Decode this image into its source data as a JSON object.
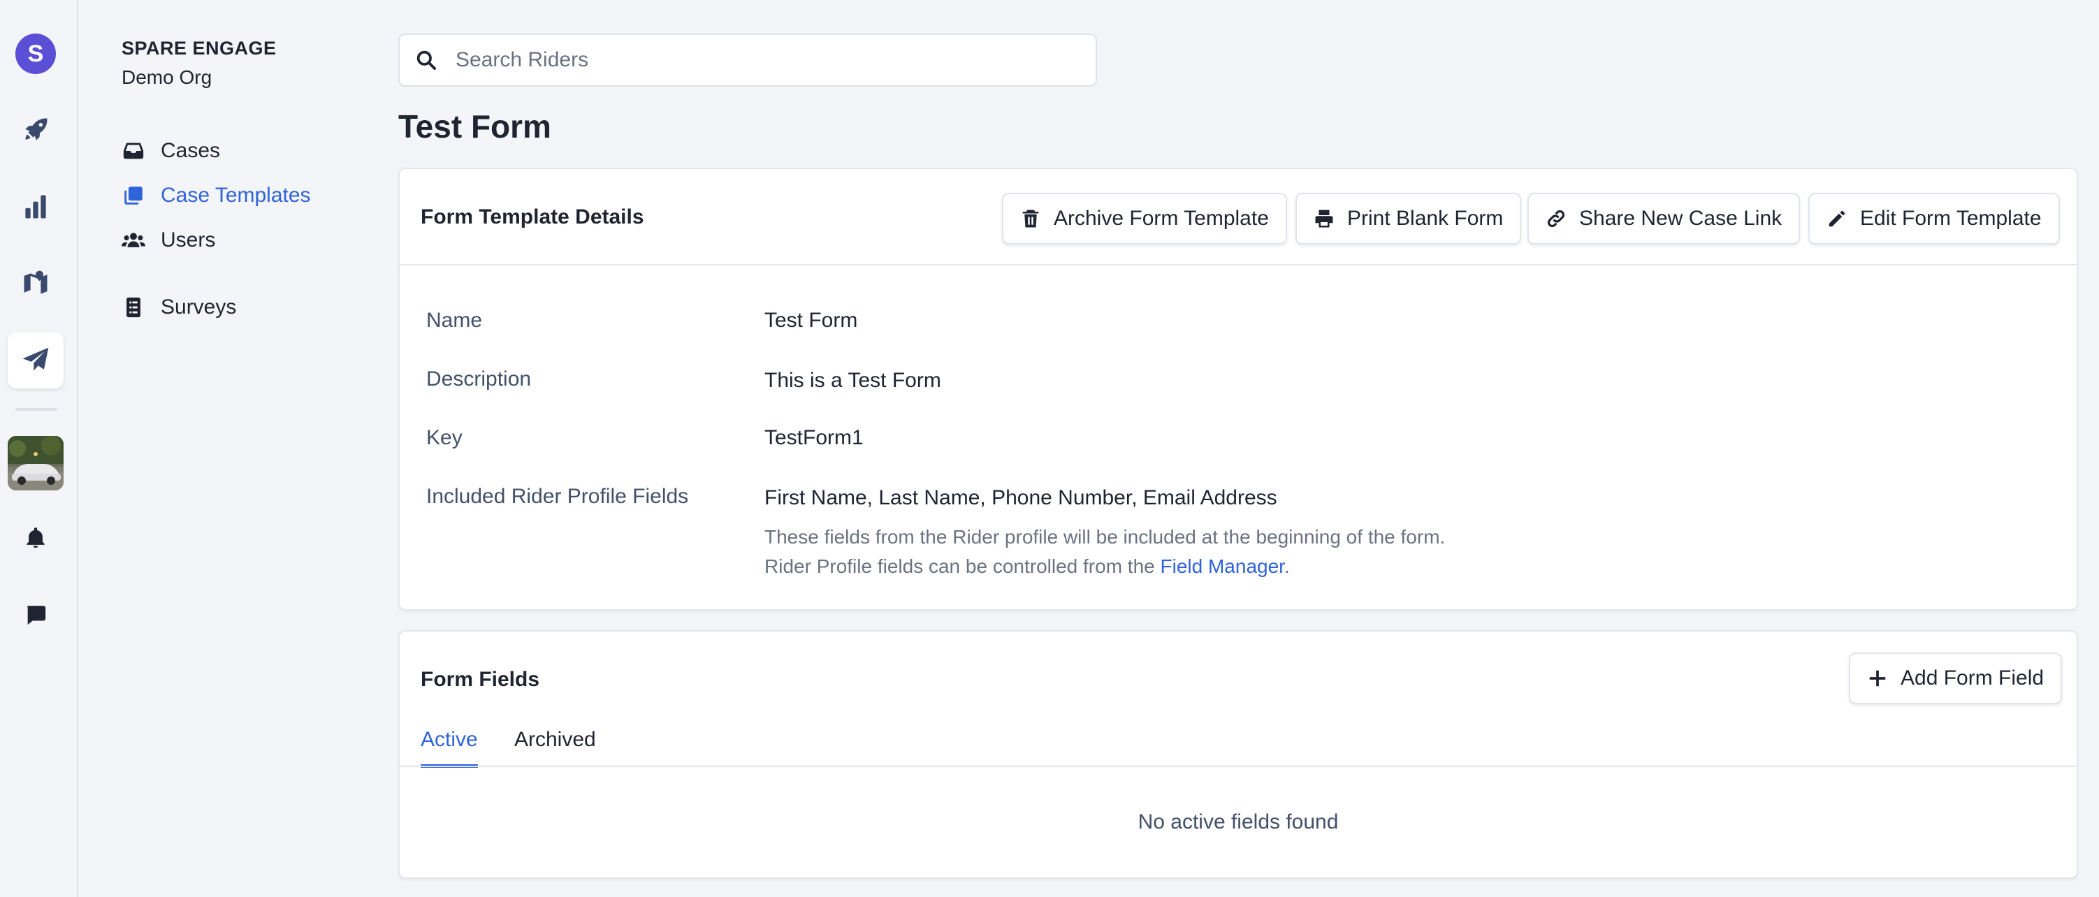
{
  "app": {
    "org_initial": "S",
    "org_title": "SPARE ENGAGE",
    "org_subtitle": "Demo Org"
  },
  "rail": {
    "icons": [
      "rocket-icon",
      "bar-chart-icon",
      "map-icon",
      "paper-plane-icon",
      "car-photo",
      "bell-icon",
      "chat-icon"
    ],
    "active": "paper-plane-icon"
  },
  "nav": {
    "items": [
      {
        "label": "Cases",
        "icon": "inbox-icon"
      },
      {
        "label": "Case Templates",
        "icon": "copy-icon",
        "active": true
      },
      {
        "label": "Users",
        "icon": "users-icon"
      },
      {
        "label": "Surveys",
        "icon": "list-icon"
      }
    ]
  },
  "search": {
    "placeholder": "Search Riders"
  },
  "page": {
    "title": "Test Form"
  },
  "details": {
    "header": "Form Template Details",
    "actions": {
      "archive": "Archive Form Template",
      "print": "Print Blank Form",
      "share": "Share New Case Link",
      "edit": "Edit Form Template"
    },
    "rows": [
      {
        "label": "Name",
        "value": "Test Form"
      },
      {
        "label": "Description",
        "value": "This is a Test Form"
      },
      {
        "label": "Key",
        "value": "TestForm1"
      },
      {
        "label": "Included Rider Profile Fields",
        "value": "First Name, Last Name, Phone Number, Email Address"
      }
    ],
    "help_text_before": "These fields from the Rider profile will be included at the beginning of the form. Rider Profile fields can be controlled from the ",
    "help_link": "Field Manager",
    "help_text_after": "."
  },
  "fields": {
    "header": "Form Fields",
    "add_button": "Add Form Field",
    "tabs": [
      {
        "label": "Active",
        "active": true
      },
      {
        "label": "Archived",
        "active": false
      }
    ],
    "empty_message": "No active fields found"
  },
  "colors": {
    "accent": "#2f63d9",
    "org_avatar": "#5b4fd6",
    "icon": "#394a6d"
  }
}
